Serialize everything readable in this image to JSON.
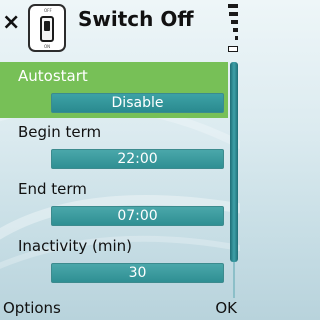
{
  "header": {
    "close_label": "×",
    "title": "Switch Off",
    "icon_label_top": "OFF",
    "icon_label_bottom": "ON"
  },
  "settings": [
    {
      "label": "Autostart",
      "value": "Disable",
      "selected": true
    },
    {
      "label": "Begin term",
      "value": "22:00",
      "selected": false
    },
    {
      "label": "End term",
      "value": "07:00",
      "selected": false
    },
    {
      "label": "Inactivity (min)",
      "value": "30",
      "selected": false
    }
  ],
  "softkeys": {
    "left": "Options",
    "right": "OK"
  },
  "colors": {
    "selected_row": "#77c057",
    "value_box": "#3a9a9e",
    "scroll_thumb": "#2e8a92"
  }
}
